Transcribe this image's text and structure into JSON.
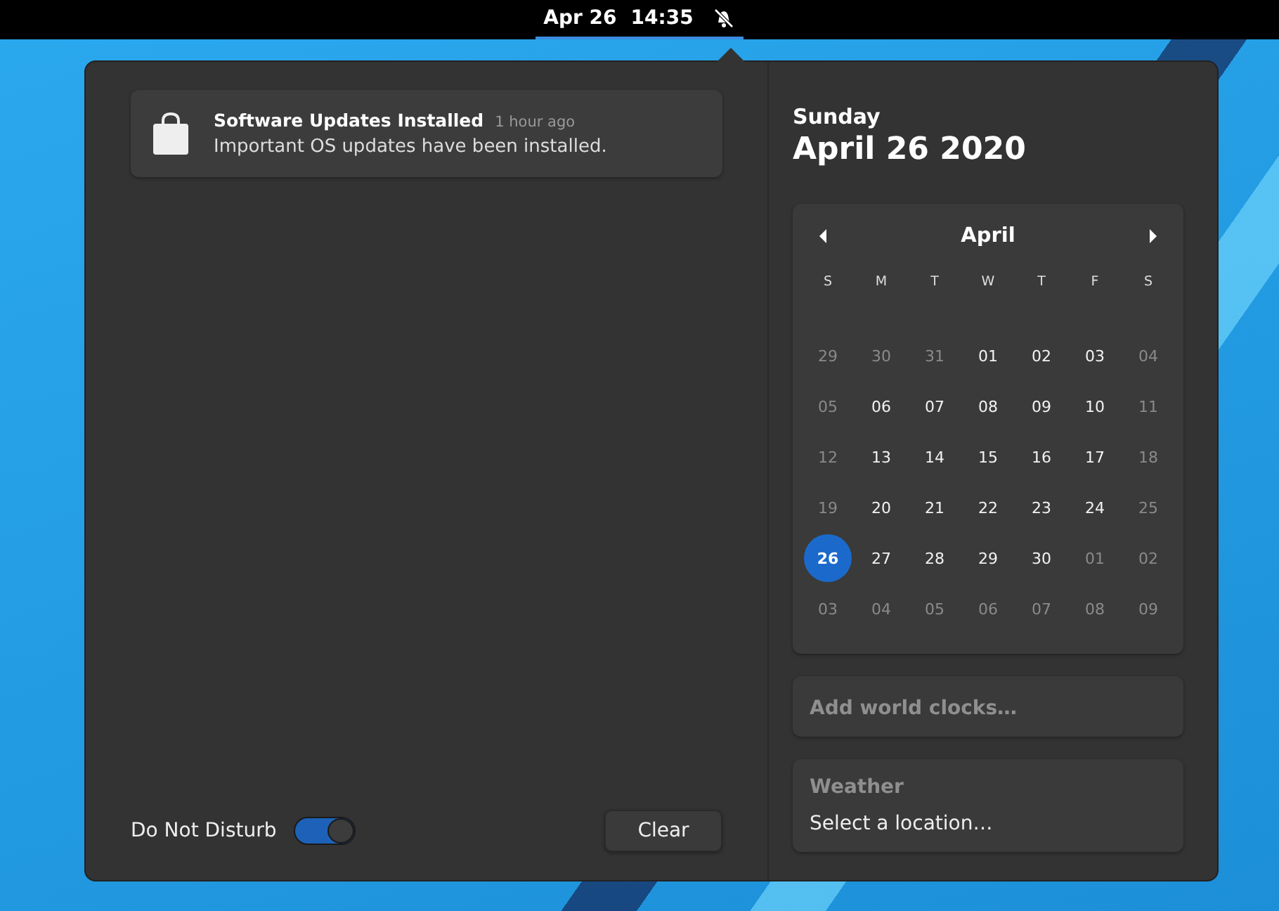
{
  "top_bar": {
    "date": "Apr 26",
    "time": "14:35"
  },
  "notifications": [
    {
      "title": "Software Updates Installed",
      "time": "1 hour ago",
      "body": "Important OS updates have been installed."
    }
  ],
  "do_not_disturb": {
    "label": "Do Not Disturb",
    "on": true
  },
  "clear_button": "Clear",
  "date_header": {
    "weekday": "Sunday",
    "date": "April 26 2020"
  },
  "calendar": {
    "month": "April",
    "weekdays": [
      "S",
      "M",
      "T",
      "W",
      "T",
      "F",
      "S"
    ],
    "days": [
      {
        "label": "29",
        "dimmed": true,
        "selected": false
      },
      {
        "label": "30",
        "dimmed": true,
        "selected": false
      },
      {
        "label": "31",
        "dimmed": true,
        "selected": false
      },
      {
        "label": "01",
        "dimmed": false,
        "selected": false
      },
      {
        "label": "02",
        "dimmed": false,
        "selected": false
      },
      {
        "label": "03",
        "dimmed": false,
        "selected": false
      },
      {
        "label": "04",
        "dimmed": true,
        "selected": false
      },
      {
        "label": "05",
        "dimmed": true,
        "selected": false
      },
      {
        "label": "06",
        "dimmed": false,
        "selected": false
      },
      {
        "label": "07",
        "dimmed": false,
        "selected": false
      },
      {
        "label": "08",
        "dimmed": false,
        "selected": false
      },
      {
        "label": "09",
        "dimmed": false,
        "selected": false
      },
      {
        "label": "10",
        "dimmed": false,
        "selected": false
      },
      {
        "label": "11",
        "dimmed": true,
        "selected": false
      },
      {
        "label": "12",
        "dimmed": true,
        "selected": false
      },
      {
        "label": "13",
        "dimmed": false,
        "selected": false
      },
      {
        "label": "14",
        "dimmed": false,
        "selected": false
      },
      {
        "label": "15",
        "dimmed": false,
        "selected": false
      },
      {
        "label": "16",
        "dimmed": false,
        "selected": false
      },
      {
        "label": "17",
        "dimmed": false,
        "selected": false
      },
      {
        "label": "18",
        "dimmed": true,
        "selected": false
      },
      {
        "label": "19",
        "dimmed": true,
        "selected": false
      },
      {
        "label": "20",
        "dimmed": false,
        "selected": false
      },
      {
        "label": "21",
        "dimmed": false,
        "selected": false
      },
      {
        "label": "22",
        "dimmed": false,
        "selected": false
      },
      {
        "label": "23",
        "dimmed": false,
        "selected": false
      },
      {
        "label": "24",
        "dimmed": false,
        "selected": false
      },
      {
        "label": "25",
        "dimmed": true,
        "selected": false
      },
      {
        "label": "26",
        "dimmed": false,
        "selected": true
      },
      {
        "label": "27",
        "dimmed": false,
        "selected": false
      },
      {
        "label": "28",
        "dimmed": false,
        "selected": false
      },
      {
        "label": "29",
        "dimmed": false,
        "selected": false
      },
      {
        "label": "30",
        "dimmed": false,
        "selected": false
      },
      {
        "label": "01",
        "dimmed": true,
        "selected": false
      },
      {
        "label": "02",
        "dimmed": true,
        "selected": false
      },
      {
        "label": "03",
        "dimmed": true,
        "selected": false
      },
      {
        "label": "04",
        "dimmed": true,
        "selected": false
      },
      {
        "label": "05",
        "dimmed": true,
        "selected": false
      },
      {
        "label": "06",
        "dimmed": true,
        "selected": false
      },
      {
        "label": "07",
        "dimmed": true,
        "selected": false
      },
      {
        "label": "08",
        "dimmed": true,
        "selected": false
      },
      {
        "label": "09",
        "dimmed": true,
        "selected": false
      }
    ]
  },
  "world_clocks": {
    "label": "Add world clocks…"
  },
  "weather": {
    "title": "Weather",
    "action": "Select a location…"
  }
}
